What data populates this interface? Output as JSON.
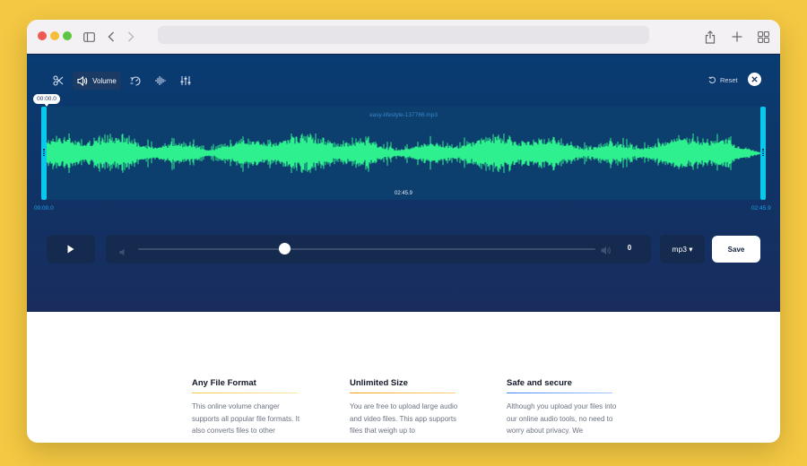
{
  "browser": {
    "icons": [
      "sidebar-icon",
      "back-icon",
      "forward-icon",
      "share-icon",
      "new-tab-icon",
      "tab-overview-icon"
    ]
  },
  "editor": {
    "toolbar": {
      "tools": [
        {
          "icon": "scissors-icon",
          "label": ""
        },
        {
          "icon": "volume-icon",
          "label": "Volume"
        },
        {
          "icon": "speed-icon",
          "label": ""
        },
        {
          "icon": "waveform-icon",
          "label": ""
        },
        {
          "icon": "equalizer-icon",
          "label": ""
        }
      ],
      "reset_label": "Reset"
    },
    "waveform": {
      "file_name": "easy-lifestyle-137766.mp3",
      "start_marker": "00:00.0",
      "mid_time": "02:45.9",
      "time_start": "00:00.0",
      "time_end": "02:45.9",
      "color": "#2ef08f"
    },
    "controls": {
      "volume_position": 0.32,
      "volume_value": "0",
      "format_label": "mp3 ▾",
      "save_label": "Save"
    }
  },
  "features": [
    {
      "title": "Any File Format",
      "text": "This online volume changer supports all popular file formats. It also converts files to other",
      "accent": "#f4c842"
    },
    {
      "title": "Unlimited Size",
      "text": "You are free to upload large audio and video files. This app supports files that weigh up to",
      "accent": "#f59e0b"
    },
    {
      "title": "Safe and secure",
      "text": "Although you upload your files into our online audio tools, no need to worry about privacy. We",
      "accent": "#3b82f6"
    }
  ],
  "colors": {
    "background": "#f4c842",
    "editor_top": "#083c72",
    "editor_bottom": "#1a2c5e",
    "handle": "#08c8ee",
    "time_text": "#1aa6e4"
  }
}
